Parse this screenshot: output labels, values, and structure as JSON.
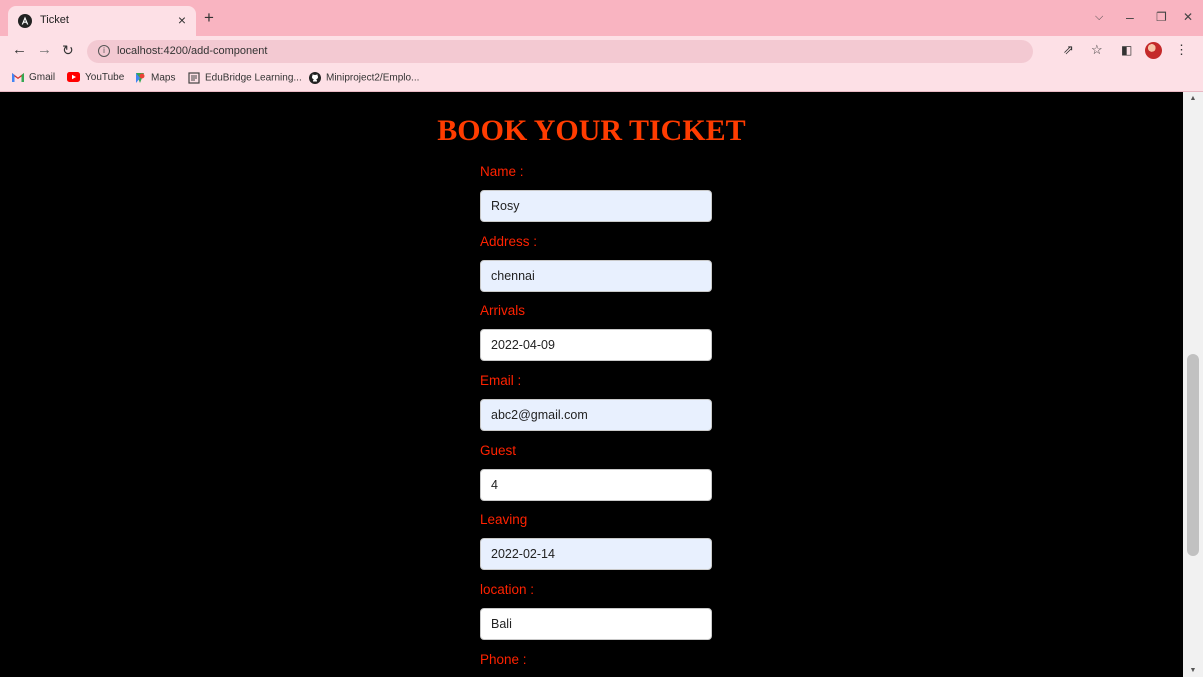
{
  "browser": {
    "tab_title": "Ticket",
    "tab_close": "×",
    "new_tab": "+",
    "url": "localhost:4200/add-component",
    "window_controls": {
      "dropdown": "⌵",
      "minimize": "–",
      "restore": "❐",
      "close": "✕"
    },
    "bookmarks": [
      {
        "label": "Gmail",
        "icon": "gmail-icon"
      },
      {
        "label": "YouTube",
        "icon": "youtube-icon"
      },
      {
        "label": "Maps",
        "icon": "maps-icon"
      },
      {
        "label": "EduBridge Learning...",
        "icon": "edubridge-icon"
      },
      {
        "label": "Miniproject2/Emplo...",
        "icon": "github-icon"
      }
    ],
    "colors": {
      "tabstrip": "#f9b4c1",
      "toolbar": "#fde0e6"
    }
  },
  "form": {
    "title": "BOOK YOUR TICKET",
    "fields": [
      {
        "label": "Name :",
        "value": "Rosy"
      },
      {
        "label": "Address :",
        "value": "chennai"
      },
      {
        "label": "Arrivals",
        "value": "2022-04-09"
      },
      {
        "label": "Email :",
        "value": "abc2@gmail.com"
      },
      {
        "label": "Guest",
        "value": "4"
      },
      {
        "label": "Leaving",
        "value": "2022-02-14"
      },
      {
        "label": "location :",
        "value": "Bali"
      },
      {
        "label": "Phone :",
        "value": ""
      }
    ],
    "colors": {
      "title": "#ff3c00",
      "label": "#ff2200",
      "autofill_bg": "#e8f0fe",
      "background": "#000000"
    }
  }
}
